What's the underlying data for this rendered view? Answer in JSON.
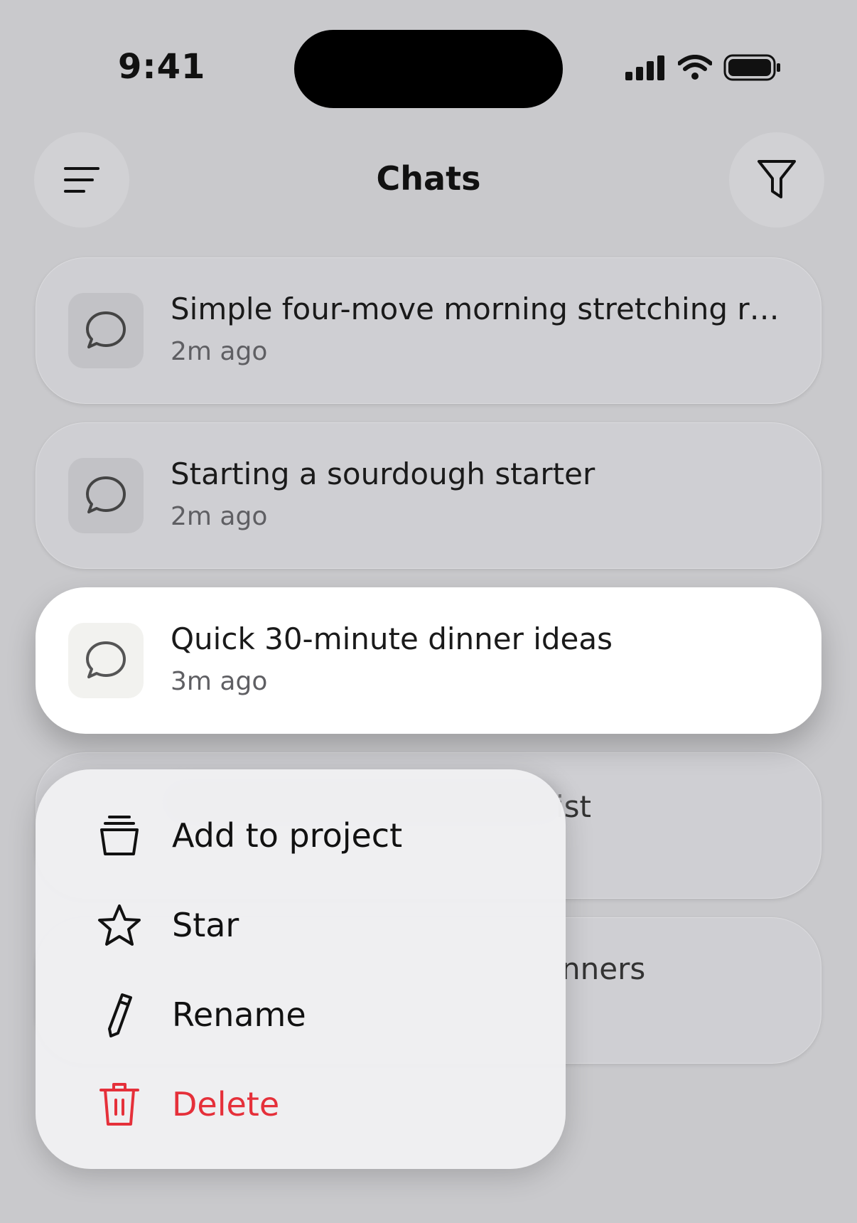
{
  "status_bar": {
    "time": "9:41"
  },
  "header": {
    "title": "Chats",
    "menu_icon": "hamburger-icon",
    "filter_icon": "filter-icon"
  },
  "chats": [
    {
      "title": "Simple four-move morning stretching r…",
      "time": "2m ago"
    },
    {
      "title": "Starting a sourdough starter",
      "time": "2m ago"
    },
    {
      "title": "Quick 30-minute dinner ideas",
      "time": "3m ago"
    },
    {
      "title": "ist",
      "time": ""
    },
    {
      "title": "nners",
      "time": ""
    }
  ],
  "context_menu": {
    "items": [
      {
        "label": "Add to project",
        "icon": "project-icon"
      },
      {
        "label": "Star",
        "icon": "star-icon"
      },
      {
        "label": "Rename",
        "icon": "pencil-icon"
      },
      {
        "label": "Delete",
        "icon": "trash-icon"
      }
    ]
  },
  "colors": {
    "danger": "#e5303a",
    "background": "#c9c9cc"
  }
}
